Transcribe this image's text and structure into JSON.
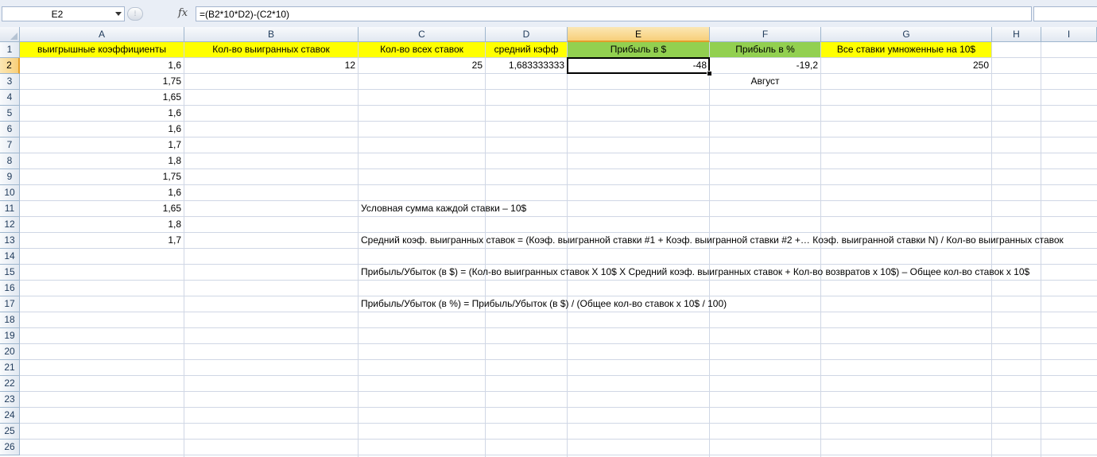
{
  "formula_bar": {
    "name_box": "E2",
    "fx": "fx",
    "formula": "=(B2*10*D2)-(C2*10)"
  },
  "columns": [
    "A",
    "B",
    "C",
    "D",
    "E",
    "F",
    "G",
    "H",
    "I"
  ],
  "rows": [
    "1",
    "2",
    "3",
    "4",
    "5",
    "6",
    "7",
    "8",
    "9",
    "10",
    "11",
    "12",
    "13",
    "14",
    "15",
    "16",
    "17",
    "18",
    "19",
    "20",
    "21",
    "22",
    "23",
    "24",
    "25",
    "26"
  ],
  "cells": {
    "A1": "выигрышные коэффициенты",
    "B1": "Кол-во выигранных ставок",
    "C1": "Кол-во всех ставок",
    "D1": "средний кэфф",
    "E1": "Прибыль в $",
    "F1": "Прибыль в %",
    "G1": "Все ставки умноженные на 10$",
    "A2": "1,6",
    "B2": "12",
    "C2": "25",
    "D2": "1,683333333",
    "E2": "-48",
    "F2": "-19,2",
    "G2": "250",
    "A3": "1,75",
    "F3": "Август",
    "A4": "1,65",
    "A5": "1,6",
    "A6": "1,6",
    "A7": "1,7",
    "A8": "1,8",
    "A9": "1,75",
    "A10": "1,6",
    "A11": "1,65",
    "C11": "Условная сумма каждой ставки – 10$",
    "A12": "1,8",
    "A13": "1,7",
    "C13": "Средний коэф. выигранных ставок = (Коэф. выигранной ставки #1 + Коэф. выигранной ставки #2 +… Коэф. выигранной ставки N) / Кол-во выигранных ставок",
    "C15": "Прибыль/Убыток (в $) = (Кол-во выигранных ставок Х 10$ Х Средний коэф. выигранных ставок + Кол-во возвратов х 10$) – Общее кол-во ставок х 10$",
    "C17": "Прибыль/Убыток (в %) = Прибыль/Убыток (в $) / (Общее кол-во ставок х 10$ / 100)"
  },
  "selected_cell": "E2",
  "colors": {
    "header_yellow": "#ffff00",
    "header_green": "#92d050",
    "gridline": "#d0d7e5"
  }
}
